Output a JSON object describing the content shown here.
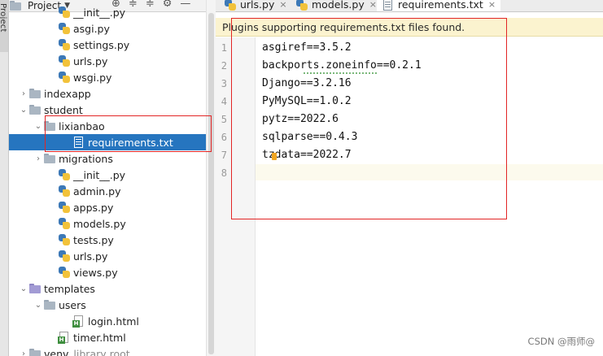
{
  "side_strip": {
    "label": "Project"
  },
  "project_panel": {
    "header_title": "Project",
    "header_caret": "▼",
    "tools": [
      "⊕",
      "≑",
      "≑",
      "⚙",
      "—"
    ],
    "rows": [
      {
        "label": "__init__.py",
        "type": "py",
        "indent": 62,
        "arrow": ""
      },
      {
        "label": "asgi.py",
        "type": "py",
        "indent": 62,
        "arrow": ""
      },
      {
        "label": "settings.py",
        "type": "py",
        "indent": 62,
        "arrow": ""
      },
      {
        "label": "urls.py",
        "type": "py",
        "indent": 62,
        "arrow": ""
      },
      {
        "label": "wsgi.py",
        "type": "py",
        "indent": 62,
        "arrow": ""
      },
      {
        "label": "indexapp",
        "type": "folder",
        "indent": 26,
        "arrow": "›"
      },
      {
        "label": "student",
        "type": "folder",
        "indent": 26,
        "arrow": "⌄"
      },
      {
        "label": "lixianbao",
        "type": "folder",
        "indent": 44,
        "arrow": "⌄"
      },
      {
        "label": "requirements.txt",
        "type": "txt",
        "indent": 80,
        "arrow": "",
        "selected": true
      },
      {
        "label": "migrations",
        "type": "folder",
        "indent": 44,
        "arrow": "›"
      },
      {
        "label": "__init__.py",
        "type": "py",
        "indent": 62,
        "arrow": ""
      },
      {
        "label": "admin.py",
        "type": "py",
        "indent": 62,
        "arrow": ""
      },
      {
        "label": "apps.py",
        "type": "py",
        "indent": 62,
        "arrow": ""
      },
      {
        "label": "models.py",
        "type": "py",
        "indent": 62,
        "arrow": ""
      },
      {
        "label": "tests.py",
        "type": "py",
        "indent": 62,
        "arrow": ""
      },
      {
        "label": "urls.py",
        "type": "py",
        "indent": 62,
        "arrow": ""
      },
      {
        "label": "views.py",
        "type": "py",
        "indent": 62,
        "arrow": ""
      },
      {
        "label": "templates",
        "type": "folder-purple",
        "indent": 26,
        "arrow": "⌄"
      },
      {
        "label": "users",
        "type": "folder",
        "indent": 44,
        "arrow": "⌄"
      },
      {
        "label": "login.html",
        "type": "html",
        "indent": 80,
        "arrow": ""
      },
      {
        "label": "timer.html",
        "type": "html",
        "indent": 62,
        "arrow": ""
      },
      {
        "label": "venv",
        "type": "folder",
        "indent": 26,
        "arrow": "›",
        "muted": "library root"
      }
    ]
  },
  "editor": {
    "tabs": [
      {
        "label": "urls.py",
        "icon": "py",
        "active": false
      },
      {
        "label": "models.py",
        "icon": "py",
        "active": false
      },
      {
        "label": "requirements.txt",
        "icon": "txt",
        "active": true
      }
    ],
    "tab_close": "×",
    "notification": "Plugins supporting requirements.txt files found.",
    "lines": [
      {
        "num": "1",
        "text": "asgiref==3.5.2"
      },
      {
        "num": "2",
        "text": "backports.zoneinfo==0.2.1"
      },
      {
        "num": "3",
        "text": "Django==3.2.16"
      },
      {
        "num": "4",
        "text": "PyMySQL==1.0.2"
      },
      {
        "num": "5",
        "text": "pytz==2022.6"
      },
      {
        "num": "6",
        "text": "sqlparse==0.4.3"
      },
      {
        "num": "7",
        "text": "tzdata==2022.7"
      },
      {
        "num": "8",
        "text": ""
      }
    ]
  },
  "watermark": "CSDN @雨师@",
  "colors": {
    "selection": "#2675bf",
    "annotation_red": "#e22525",
    "notification_bg": "#fbf3cf"
  }
}
